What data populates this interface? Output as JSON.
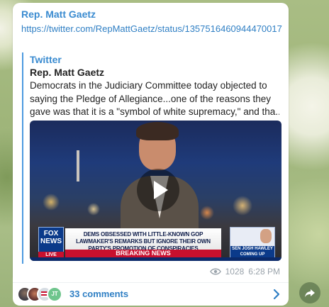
{
  "message": {
    "sender": "Rep. Matt Gaetz",
    "link": "https://twitter.com/RepMattGaetz/status/1357516460944470017",
    "preview": {
      "site": "Twitter",
      "title": "Rep. Matt Gaetz",
      "description_lines": [
        "Democrats in the Judiciary Committee today objected to",
        "saying the Pledge of Allegiance...one of the reasons they",
        "gave was that it is a \"symbol of white supremacy,\" and tha..."
      ],
      "video": {
        "network_logo": "FOX NEWS",
        "live_label": "LIVE",
        "headline": "DEMS OBSESSED WITH LITTLE-KNOWN GOP LAWMAKER'S REMARKS BUT IGNORE THEIR OWN PARTY'S PROMOTION OF CONSPIRACIES",
        "banner": "BREAKING NEWS",
        "side_tag": "SEN JOSH HAWLEY COMING UP"
      }
    },
    "views": "1028",
    "time": "6:28 PM"
  },
  "comments": {
    "label": "33 comments",
    "avatar_initials": "JT"
  },
  "icons": {
    "views": "eye-icon",
    "comments_arrow": "chevron-right-icon",
    "share": "share-icon",
    "play": "play-icon"
  },
  "colors": {
    "link": "#2f7fc4",
    "accent": "#3a8bd0",
    "meta": "#9aa3ab"
  }
}
